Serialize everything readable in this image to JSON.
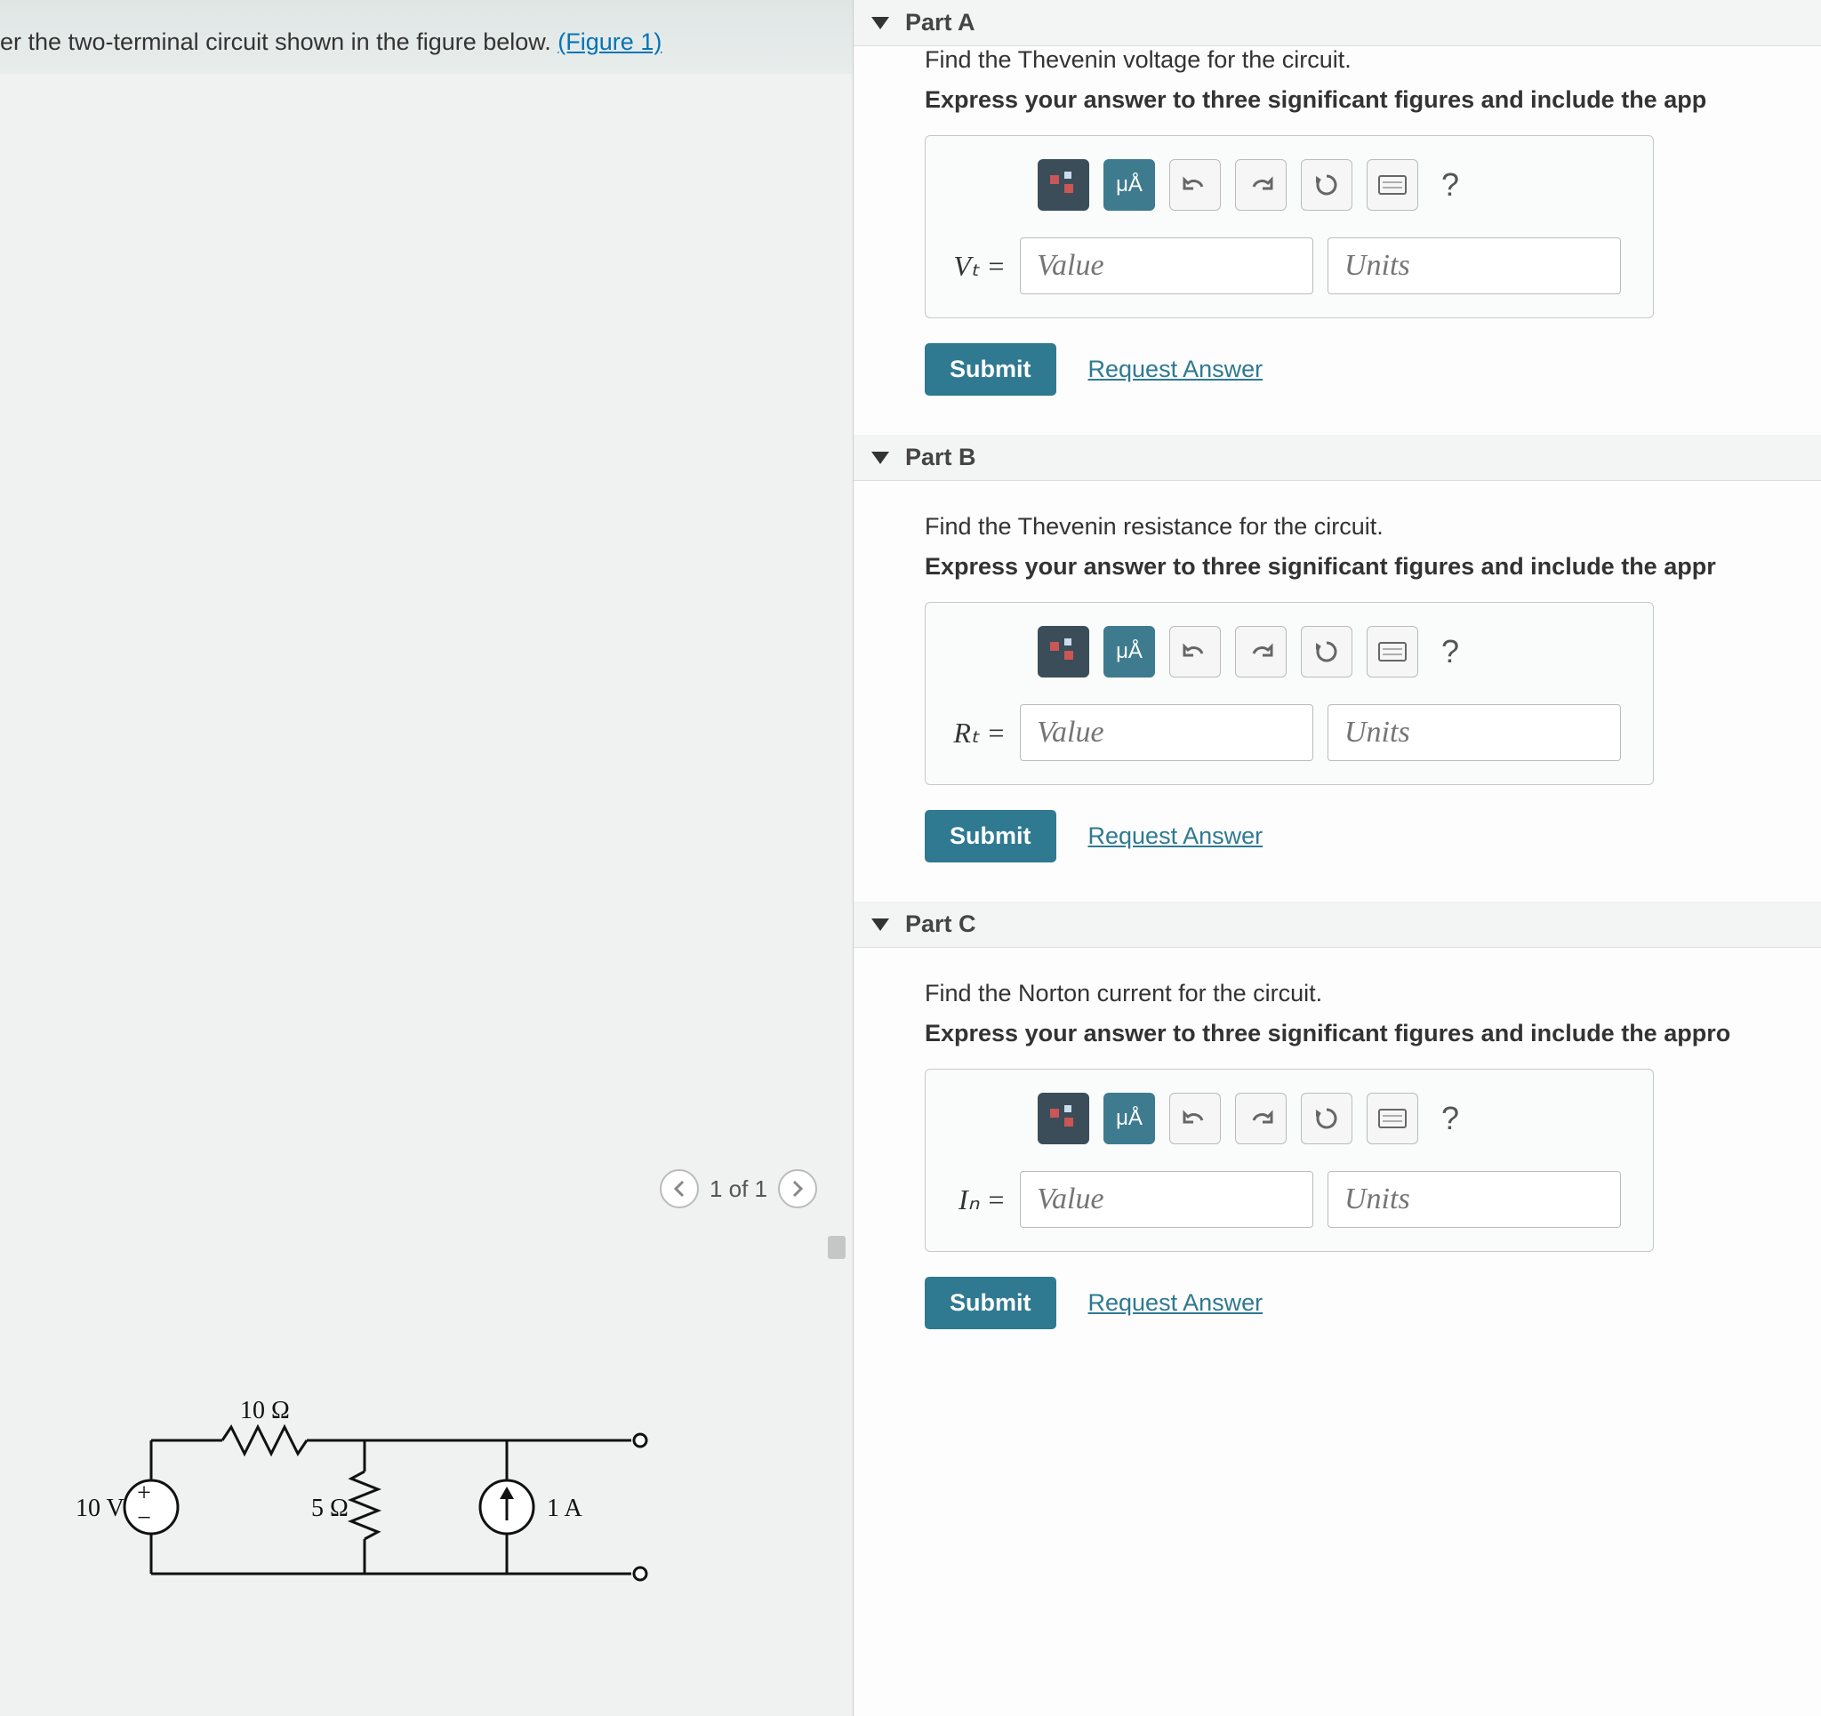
{
  "problem": {
    "intro": "er the two-terminal circuit shown in the figure below. ",
    "figure_link": "(Figure 1)"
  },
  "figure_nav": {
    "counter": "1 of 1"
  },
  "circuit": {
    "v_source": "10 V",
    "r1": "10 Ω",
    "r2": "5 Ω",
    "i_source": "1 A"
  },
  "toolbar": {
    "special_label": "μÅ",
    "help": "?"
  },
  "parts": [
    {
      "id": "A",
      "header": "Part A",
      "prompt": "Find the Thevenin voltage for the circuit.",
      "hint": "Express your answer to three significant figures and include the app",
      "var": "Vₜ =",
      "value_ph": "Value",
      "units_ph": "Units",
      "submit": "Submit",
      "request": "Request Answer"
    },
    {
      "id": "B",
      "header": "Part B",
      "prompt": "Find the Thevenin resistance for the circuit.",
      "hint": "Express your answer to three significant figures and include the appr",
      "var": "Rₜ =",
      "value_ph": "Value",
      "units_ph": "Units",
      "submit": "Submit",
      "request": "Request Answer"
    },
    {
      "id": "C",
      "header": "Part C",
      "prompt": "Find the Norton current for the circuit.",
      "hint": "Express your answer to three significant figures and include the appro",
      "var": "Iₙ =",
      "value_ph": "Value",
      "units_ph": "Units",
      "submit": "Submit",
      "request": "Request Answer"
    }
  ]
}
